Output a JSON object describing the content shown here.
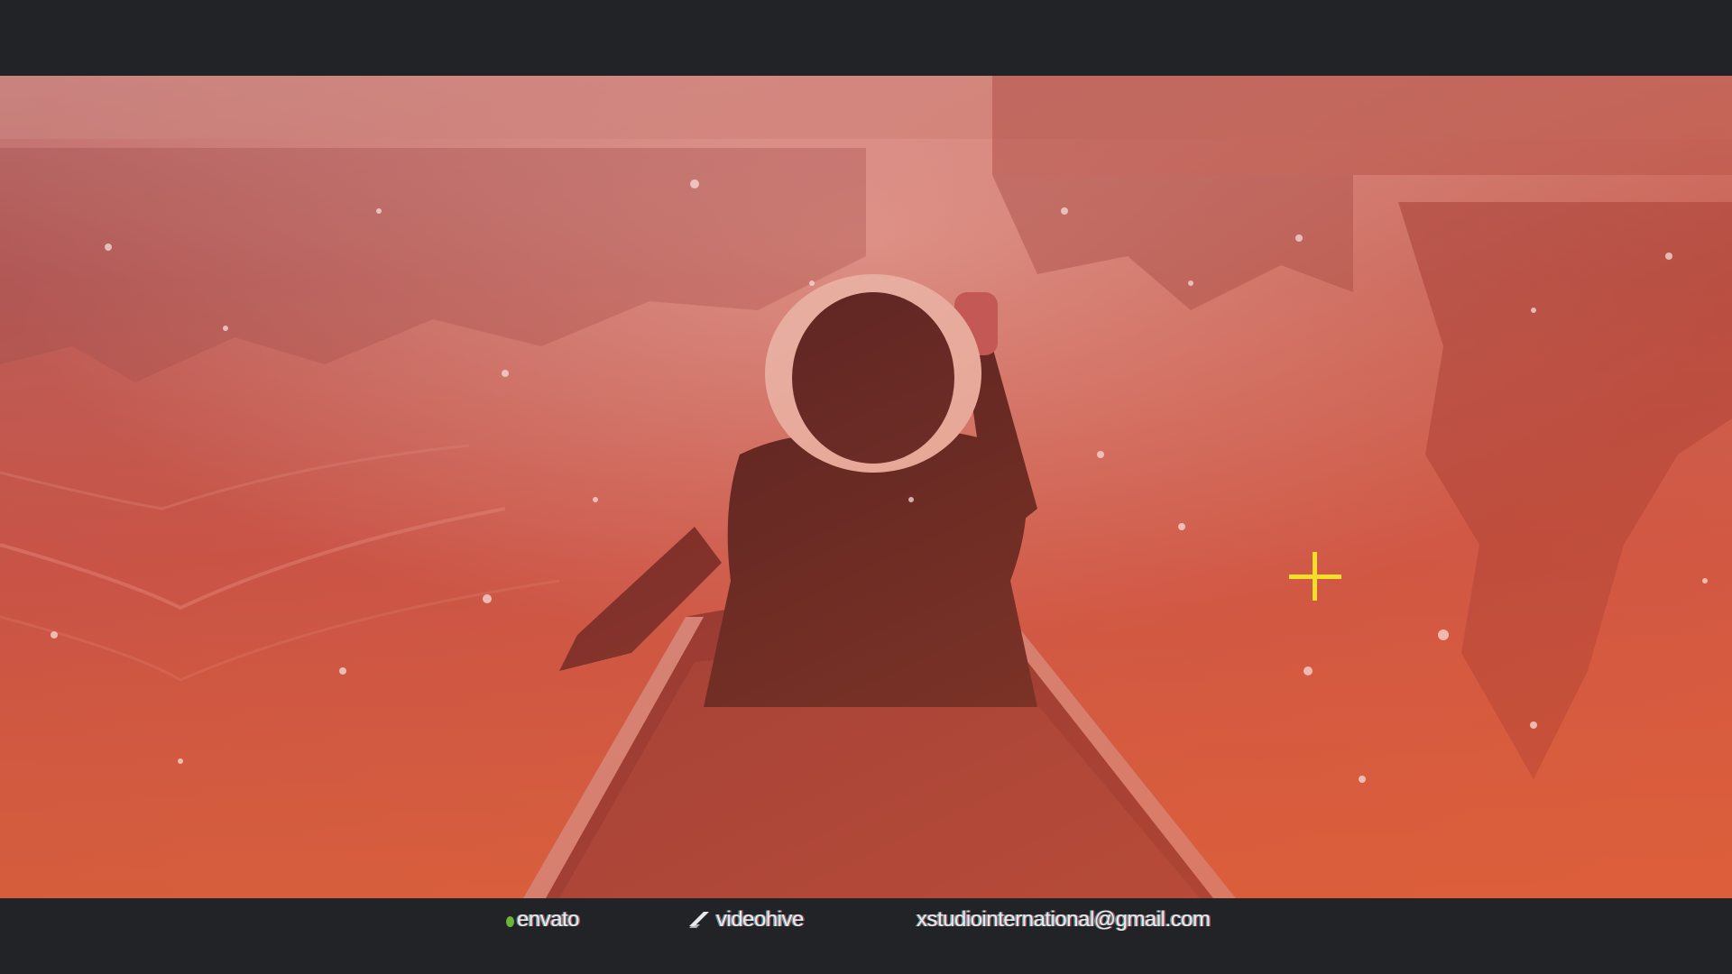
{
  "video": {
    "tint_color": "#c9504a",
    "scene_icon": "canoe-paddler-image"
  },
  "credits": {
    "envato": "envato",
    "videohive": "videohive",
    "email": "xstudiointernational@gmail.com"
  },
  "icons": {
    "envato_logo": "leaf-dot-icon",
    "videohive_logo": "slash-mark-icon",
    "cursor": "crosshair-icon"
  },
  "colors": {
    "letterbox": "#222326",
    "crosshair": "#f2df2a",
    "envato_green": "#6fb43a"
  }
}
